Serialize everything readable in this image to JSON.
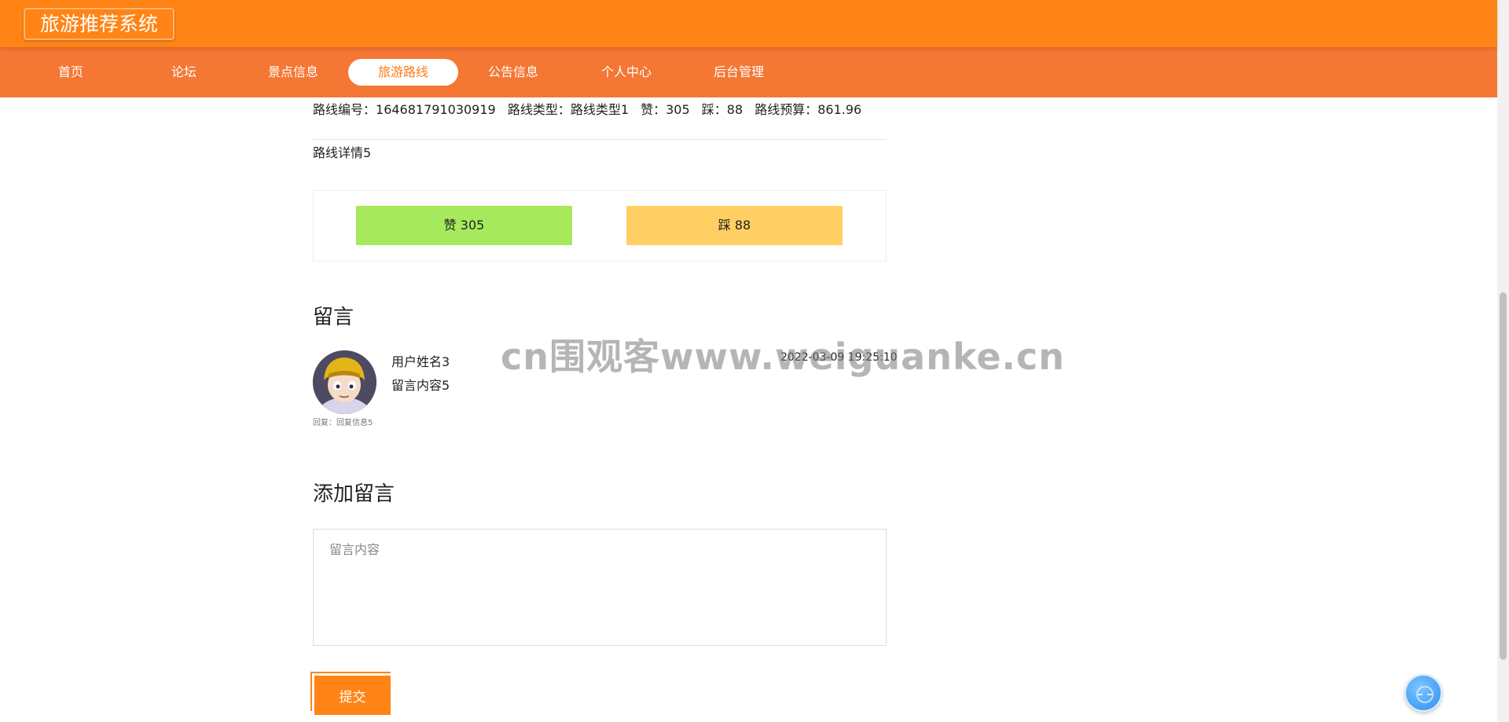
{
  "app": {
    "title": "旅游推荐系统"
  },
  "nav": {
    "items": [
      {
        "label": "首页"
      },
      {
        "label": "论坛"
      },
      {
        "label": "景点信息"
      },
      {
        "label": "旅游路线"
      },
      {
        "label": "公告信息"
      },
      {
        "label": "个人中心"
      },
      {
        "label": "后台管理"
      }
    ],
    "active": "旅游路线"
  },
  "route": {
    "number_label": "路线编号：",
    "number": "164681791030919",
    "type_label": "路线类型：",
    "type": "路线类型1",
    "like_label": "赞：",
    "likes": "305",
    "dislike_label": "踩：",
    "dislikes": "88",
    "budget_label": "路线预算：",
    "budget": "861.96",
    "detail": "路线详情5"
  },
  "vote": {
    "like_text": "赞  305",
    "dislike_text": "踩  88",
    "like_color": "#a7e95c",
    "dislike_color": "#ffcf63"
  },
  "comments": {
    "title": "留言",
    "items": [
      {
        "user": "用户姓名3",
        "content": "留言内容5",
        "time": "2022-03-09 19:25:10",
        "reply": "回复：回复信息5"
      }
    ]
  },
  "add_comment": {
    "title": "添加留言",
    "placeholder": "留言内容",
    "submit_label": "提交"
  },
  "watermark": "cn围观客www.weiguanke.cn",
  "colors": {
    "topbar": "#ff8415",
    "navbar": "#f47734",
    "accent": "#ff8415"
  }
}
